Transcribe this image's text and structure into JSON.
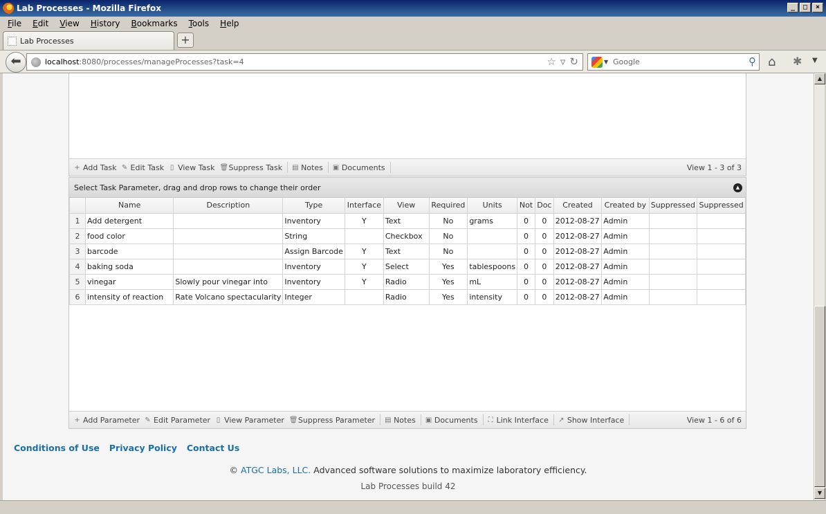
{
  "window": {
    "title": "Lab Processes - Mozilla Firefox",
    "min": "_",
    "max": "□",
    "close": "×"
  },
  "menu": [
    "File",
    "Edit",
    "View",
    "History",
    "Bookmarks",
    "Tools",
    "Help"
  ],
  "tab": {
    "label": "Lab Processes",
    "new_tab": "+"
  },
  "nav": {
    "url_host": "localhost",
    "url_path": ":8080/processes/manageProcesses?task=4",
    "search_placeholder": "Google"
  },
  "tasks_pager": {
    "buttons": [
      {
        "icon": "+",
        "label": "Add Task"
      },
      {
        "icon": "✎",
        "label": "Edit Task"
      },
      {
        "icon": "▯",
        "label": "View Task"
      },
      {
        "icon": "🗑",
        "label": "Suppress Task"
      },
      {
        "icon": "▤",
        "label": "Notes"
      },
      {
        "icon": "▣",
        "label": "Documents"
      }
    ],
    "records": "View 1 - 3 of 3"
  },
  "params": {
    "caption": "Select Task Parameter, drag and drop rows to change their order",
    "columns": [
      "Name",
      "Description",
      "Type",
      "Interface",
      "View",
      "Required",
      "Units",
      "Not",
      "Doc",
      "Created",
      "Created by",
      "Suppressed",
      "Suppressed"
    ],
    "rows": [
      {
        "n": "1",
        "name": "Add detergent",
        "desc": "",
        "type": "Inventory",
        "iface": "Y",
        "view": "Text",
        "req": "No",
        "units": "grams",
        "not": "0",
        "doc": "0",
        "created": "2012-08-27",
        "by": "Admin",
        "s1": "",
        "s2": ""
      },
      {
        "n": "2",
        "name": "food color",
        "desc": "",
        "type": "String",
        "iface": "",
        "view": "Checkbox",
        "req": "No",
        "units": "",
        "not": "0",
        "doc": "0",
        "created": "2012-08-27",
        "by": "Admin",
        "s1": "",
        "s2": ""
      },
      {
        "n": "3",
        "name": "barcode",
        "desc": "",
        "type": "Assign Barcode",
        "iface": "Y",
        "view": "Text",
        "req": "No",
        "units": "",
        "not": "0",
        "doc": "0",
        "created": "2012-08-27",
        "by": "Admin",
        "s1": "",
        "s2": ""
      },
      {
        "n": "4",
        "name": "baking soda",
        "desc": "",
        "type": "Inventory",
        "iface": "Y",
        "view": "Select",
        "req": "Yes",
        "units": "tablespoons",
        "not": "0",
        "doc": "0",
        "created": "2012-08-27",
        "by": "Admin",
        "s1": "",
        "s2": ""
      },
      {
        "n": "5",
        "name": "vinegar",
        "desc": "Slowly pour vinegar into",
        "type": "Inventory",
        "iface": "Y",
        "view": "Radio",
        "req": "Yes",
        "units": "mL",
        "not": "0",
        "doc": "0",
        "created": "2012-08-27",
        "by": "Admin",
        "s1": "",
        "s2": ""
      },
      {
        "n": "6",
        "name": "intensity of reaction",
        "desc": "Rate Volcano spectacularity",
        "type": "Integer",
        "iface": "",
        "view": "Radio",
        "req": "Yes",
        "units": "intensity",
        "not": "0",
        "doc": "0",
        "created": "2012-08-27",
        "by": "Admin",
        "s1": "",
        "s2": ""
      }
    ]
  },
  "params_pager": {
    "buttons": [
      {
        "icon": "+",
        "label": "Add Parameter"
      },
      {
        "icon": "✎",
        "label": "Edit Parameter"
      },
      {
        "icon": "▯",
        "label": "View Parameter"
      },
      {
        "icon": "🗑",
        "label": "Suppress Parameter"
      },
      {
        "icon": "▤",
        "label": "Notes"
      },
      {
        "icon": "▣",
        "label": "Documents"
      },
      {
        "icon": "⛶",
        "label": "Link Interface"
      },
      {
        "icon": "↗",
        "label": "Show Interface"
      }
    ],
    "records": "View 1 - 6 of 6"
  },
  "footer": {
    "links": [
      "Conditions of Use",
      "Privacy Policy",
      "Contact Us"
    ],
    "copy_prefix": "© ",
    "company": "ATGC Labs, LLC.",
    "tagline": " Advanced software solutions to maximize laboratory efficiency.",
    "build": "Lab Processes build 42"
  }
}
